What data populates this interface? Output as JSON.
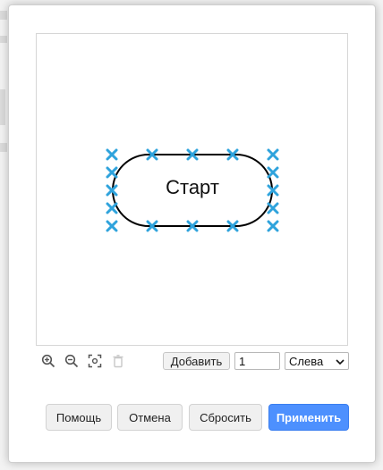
{
  "dialog": {
    "shape_label": "Старт",
    "toolbar": {
      "zoom_in_icon": "zoom-in-icon",
      "zoom_out_icon": "zoom-out-icon",
      "fit_icon": "fit-icon",
      "delete_icon": "trash-icon",
      "add_label": "Добавить",
      "count_value": "1",
      "position_selected": "Слева"
    },
    "buttons": {
      "help": "Помощь",
      "cancel": "Отмена",
      "reset": "Сбросить",
      "apply": "Применить"
    }
  },
  "colors": {
    "connection_point": "#2fa3dc",
    "primary_button": "#4d90fe"
  }
}
